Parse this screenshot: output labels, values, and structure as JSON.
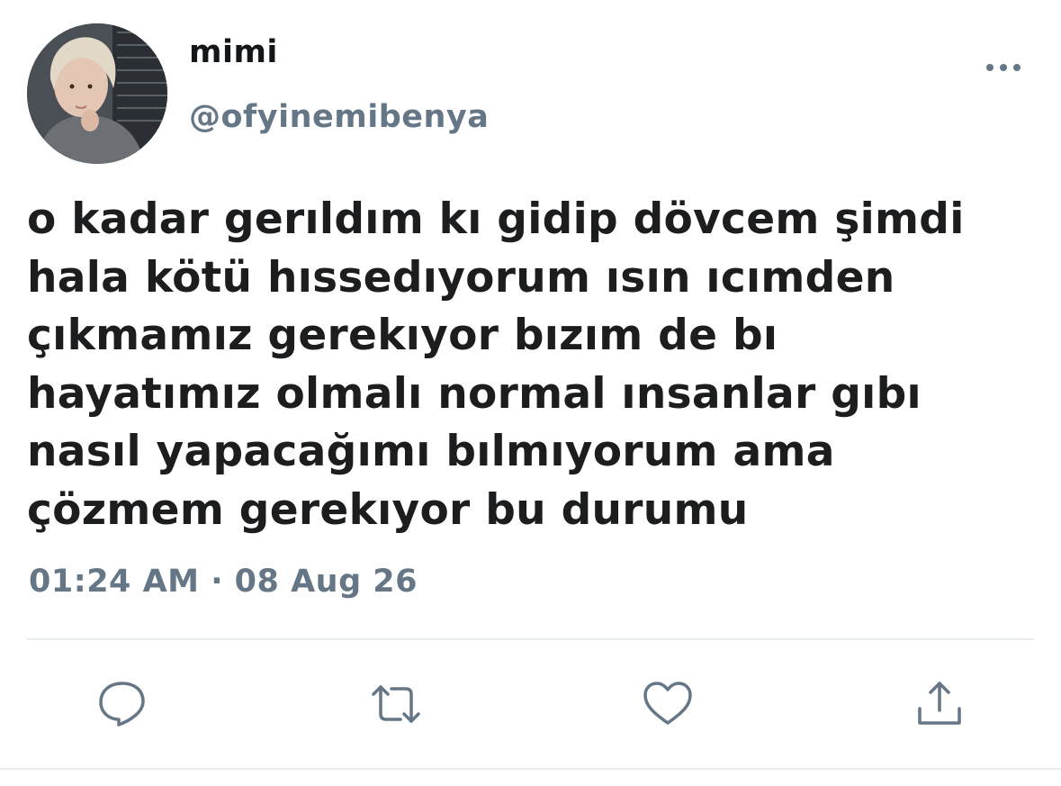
{
  "user": {
    "display_name": "mimi",
    "handle": "@ofyinemibenya"
  },
  "tweet": {
    "lines": [
      "o kadar gerıldım kı gidip dövcem şimdi",
      "hala kötü hıssedıyorum ısın ıcımden",
      "çıkmamız gerekıyor bızım de bı",
      "hayatımız olmalı normal ınsanlar gıbı",
      "nasıl yapacağımı bılmıyorum ama",
      "çözmem gerekıyor bu durumu"
    ],
    "timestamp": "01:24 AM · 08 Aug 26"
  },
  "icons": {
    "more": "more-dots-icon",
    "reply": "reply-icon",
    "retweet": "retweet-icon",
    "like": "heart-icon",
    "share": "share-icon"
  },
  "colors": {
    "text": "#14171a",
    "secondary": "#657786",
    "divider": "#e6ecf0"
  }
}
